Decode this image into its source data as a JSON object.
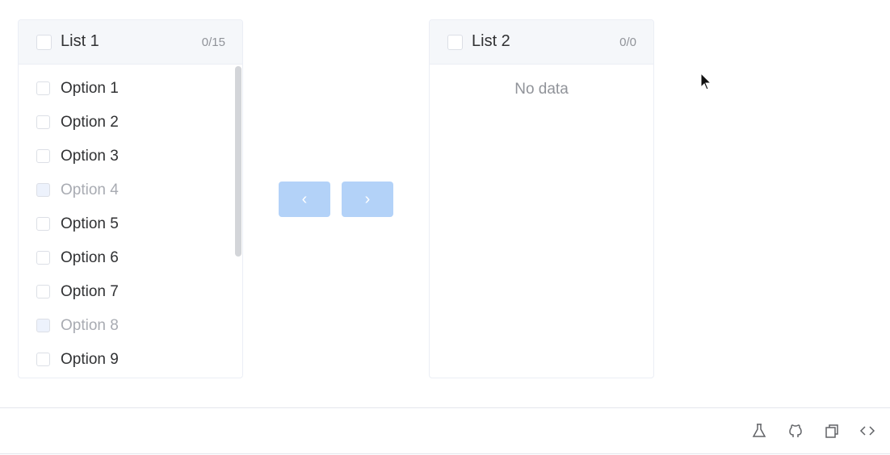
{
  "left_list": {
    "title": "List 1",
    "count": "0/15",
    "items": [
      {
        "label": "Option 1",
        "disabled": false
      },
      {
        "label": "Option 2",
        "disabled": false
      },
      {
        "label": "Option 3",
        "disabled": false
      },
      {
        "label": "Option 4",
        "disabled": true
      },
      {
        "label": "Option 5",
        "disabled": false
      },
      {
        "label": "Option 6",
        "disabled": false
      },
      {
        "label": "Option 7",
        "disabled": false
      },
      {
        "label": "Option 8",
        "disabled": true
      },
      {
        "label": "Option 9",
        "disabled": false
      }
    ]
  },
  "right_list": {
    "title": "List 2",
    "count": "0/0",
    "empty_text": "No data"
  },
  "transfer_buttons": {
    "left_icon": "chevron-left-icon",
    "right_icon": "chevron-right-icon",
    "left_glyph": "‹",
    "right_glyph": "›"
  },
  "footer": {
    "icons": [
      "flask-icon",
      "github-icon",
      "copy-icon",
      "code-icon"
    ]
  },
  "colors": {
    "button_disabled": "#b3d2f8",
    "header_bg": "#f5f7fa",
    "border": "#ebeef5",
    "text": "#303133",
    "muted": "#909399"
  }
}
